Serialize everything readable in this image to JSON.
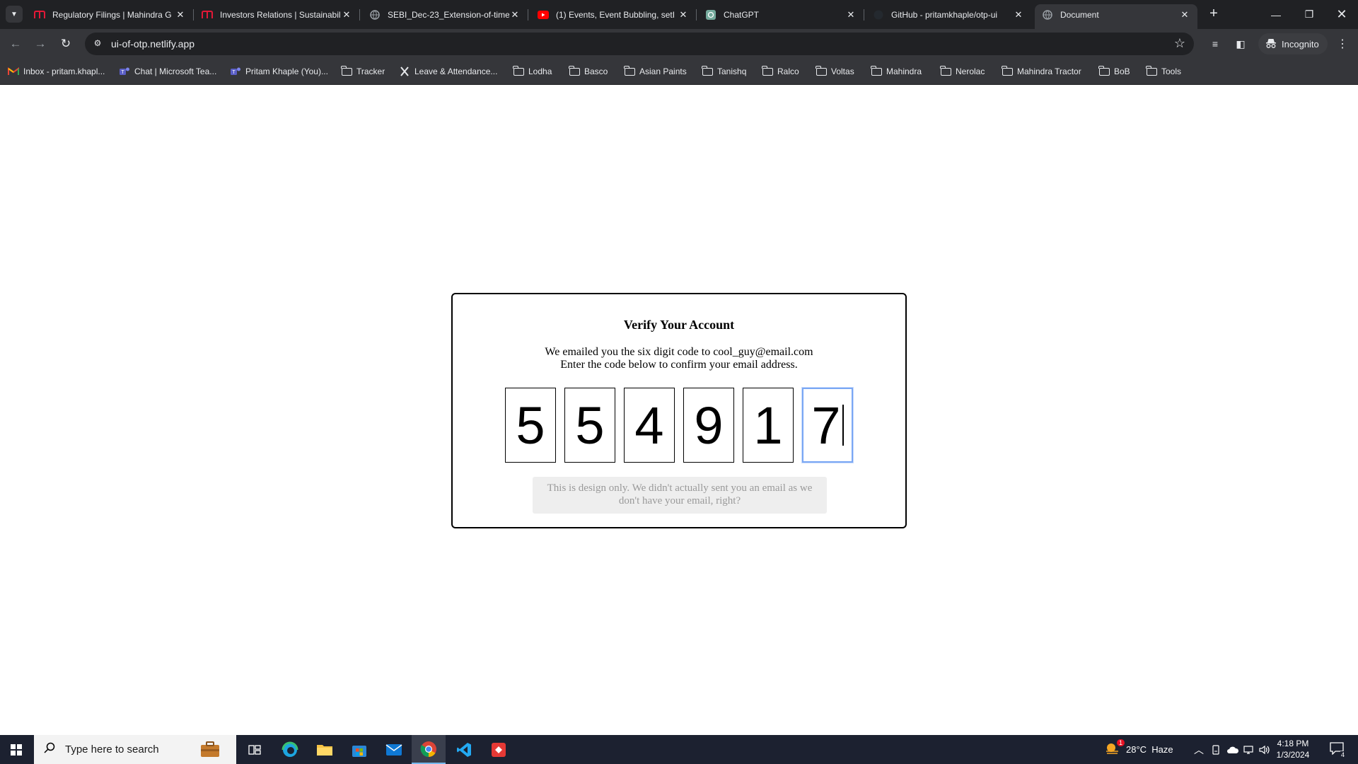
{
  "browser": {
    "tabs": [
      {
        "title": "Regulatory Filings | Mahindra G",
        "icon": "mahindra-icon",
        "color": "#e31837"
      },
      {
        "title": "Investors Relations | Sustainabil",
        "icon": "mahindra-icon",
        "color": "#e31837"
      },
      {
        "title": "SEBI_Dec-23_Extension-of-time",
        "icon": "globe-icon",
        "color": "#9aa0a6"
      },
      {
        "title": "(1) Events, Event Bubbling, setI",
        "icon": "youtube-icon",
        "color": "#ff0000"
      },
      {
        "title": "ChatGPT",
        "icon": "chatgpt-icon",
        "color": "#74aa9c"
      },
      {
        "title": "GitHub - pritamkhaple/otp-ui",
        "icon": "github-icon",
        "color": "#24292f"
      },
      {
        "title": "Document",
        "icon": "globe-icon",
        "color": "#9aa0a6"
      }
    ],
    "url": "ui-of-otp.netlify.app",
    "incognito_label": "Incognito",
    "bookmarks": [
      {
        "label": "Inbox - pritam.khapl...",
        "icon": "gmail-icon"
      },
      {
        "label": "Chat | Microsoft Tea...",
        "icon": "teams-icon"
      },
      {
        "label": "Pritam Khaple (You)...",
        "icon": "teams-icon"
      },
      {
        "label": "Tracker",
        "icon": "folder-icon"
      },
      {
        "label": "Leave & Attendance...",
        "icon": "x-icon"
      },
      {
        "label": "Lodha",
        "icon": "folder-icon"
      },
      {
        "label": "Basco",
        "icon": "folder-icon"
      },
      {
        "label": "Asian Paints",
        "icon": "folder-icon"
      },
      {
        "label": "Tanishq",
        "icon": "folder-icon"
      },
      {
        "label": "Ralco",
        "icon": "folder-icon"
      },
      {
        "label": "Voltas",
        "icon": "folder-icon"
      },
      {
        "label": "Mahindra",
        "icon": "folder-icon"
      },
      {
        "label": "Nerolac",
        "icon": "folder-icon"
      },
      {
        "label": "Mahindra Tractor",
        "icon": "folder-icon"
      },
      {
        "label": "BoB",
        "icon": "folder-icon"
      },
      {
        "label": "Tools",
        "icon": "folder-icon"
      }
    ]
  },
  "card": {
    "title": "Verify Your Account",
    "line1": "We emailed you the six digit code to cool_guy@email.com",
    "line2": "Enter the code below to confirm your email address.",
    "otp_digits": [
      "5",
      "5",
      "4",
      "9",
      "1",
      "7"
    ],
    "note": "This is design only. We didn't actually sent you an email as we don't have your email, right?"
  },
  "taskbar": {
    "search_placeholder": "Type here to search",
    "weather": "28°C  Haze",
    "weather_badge": "1",
    "time": "4:18 PM",
    "date": "1/3/2024",
    "notification_count": "4"
  }
}
